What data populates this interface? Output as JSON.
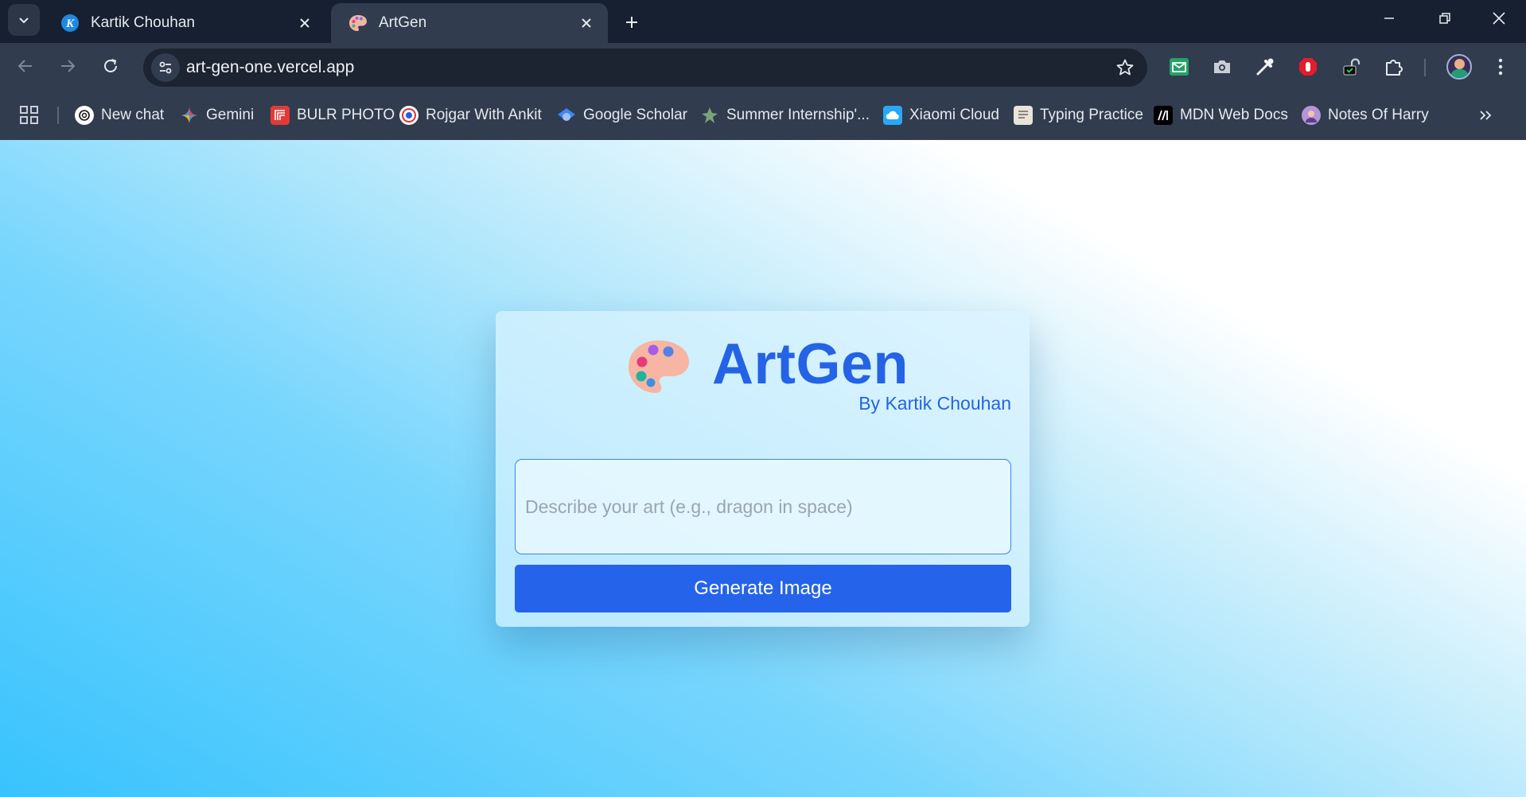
{
  "browser": {
    "tabs": [
      {
        "title": "Kartik Chouhan",
        "active": false,
        "favicon": "k-logo-icon"
      },
      {
        "title": "ArtGen",
        "active": true,
        "favicon": "palette-icon"
      }
    ],
    "address": "art-gen-one.vercel.app",
    "bookmarks": [
      {
        "label": "New chat",
        "icon": "openai-icon"
      },
      {
        "label": "Gemini",
        "icon": "gemini-icon"
      },
      {
        "label": "BULR PHOTO",
        "icon": "bulr-icon"
      },
      {
        "label": "Rojgar With Ankit",
        "icon": "rojgar-icon"
      },
      {
        "label": "Google Scholar",
        "icon": "scholar-icon"
      },
      {
        "label": "Summer Internship'...",
        "icon": "internship-icon"
      },
      {
        "label": "Xiaomi Cloud",
        "icon": "cloud-icon"
      },
      {
        "label": "Typing Practice",
        "icon": "typing-icon"
      },
      {
        "label": "MDN Web Docs",
        "icon": "mdn-icon"
      },
      {
        "label": "Notes Of Harry",
        "icon": "harry-icon"
      }
    ]
  },
  "app": {
    "title": "ArtGen",
    "byline": "By Kartik Chouhan",
    "prompt_placeholder": "Describe your art (e.g., dragon in space)",
    "prompt_value": "",
    "generate_label": "Generate Image"
  },
  "colors": {
    "accent": "#2563eb",
    "title": "#2463e6",
    "chrome_bg": "#172030",
    "toolbar_bg": "#313c4e"
  }
}
